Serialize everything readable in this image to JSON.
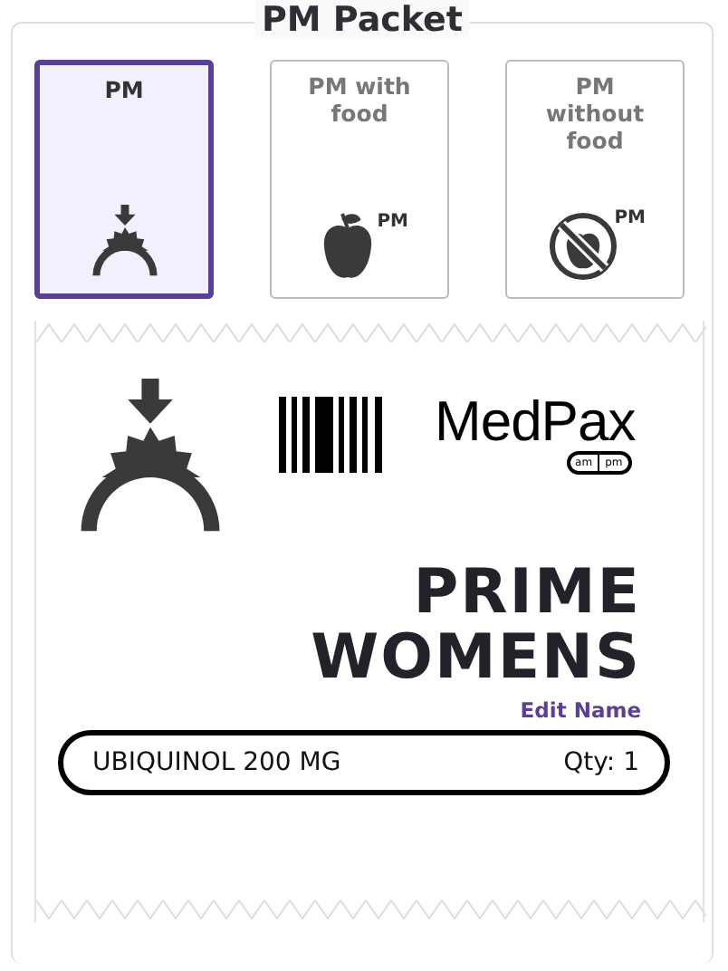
{
  "title": "PM Packet",
  "options": [
    {
      "label": "PM",
      "kind": "sunset",
      "selected": true
    },
    {
      "label": "PM with food",
      "kind": "food",
      "badge": "PM",
      "selected": false
    },
    {
      "label": "PM without food",
      "kind": "nofood",
      "badge": "PM",
      "selected": false
    }
  ],
  "packet": {
    "logo": {
      "name": "MedPax",
      "am": "am",
      "pm": "pm"
    },
    "name_lines": [
      "PRIME",
      "WOMENS"
    ],
    "edit_link": "Edit Name",
    "items": [
      {
        "name": "UBIQUINOL 200 MG",
        "qty": "Qty: 1"
      }
    ]
  }
}
